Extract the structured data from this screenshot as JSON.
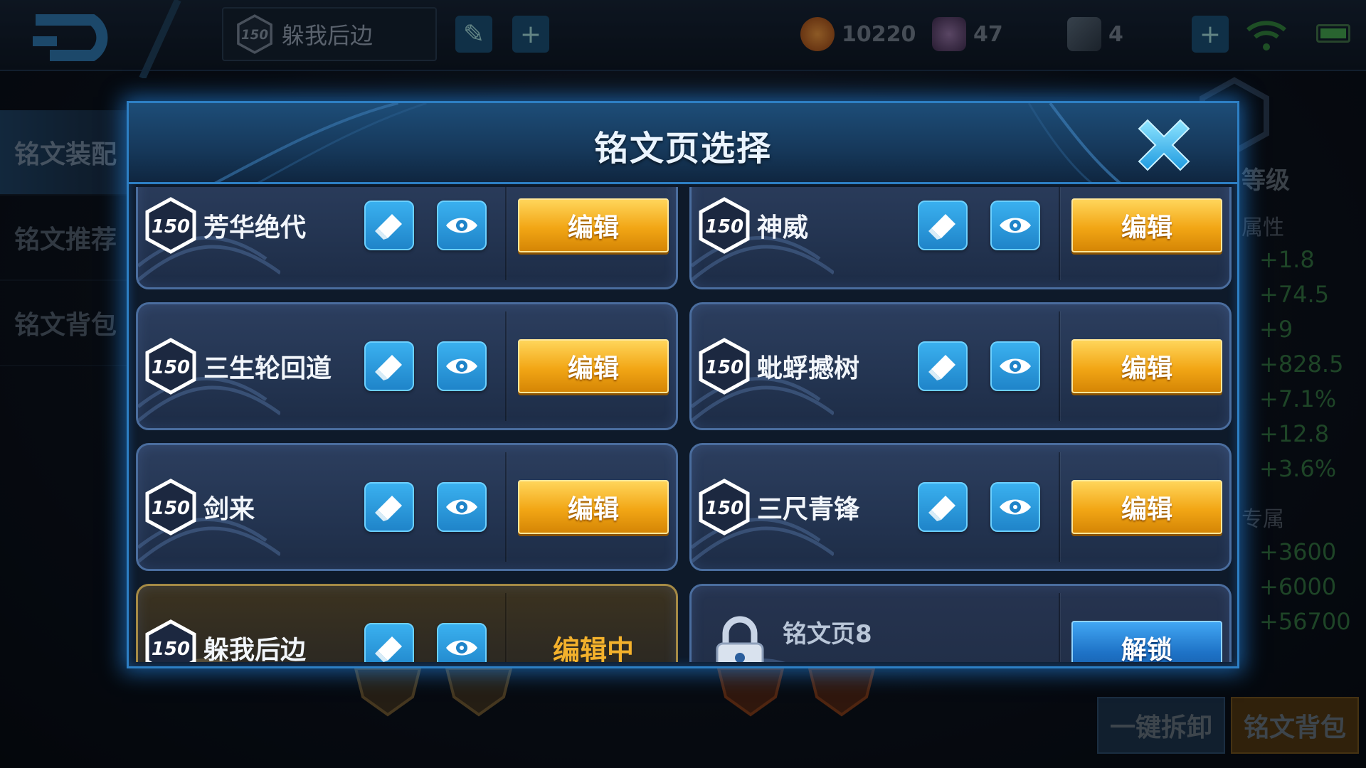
{
  "topbar": {
    "current_page_level": "150",
    "current_page_name": "躲我后边",
    "gold": "10220",
    "diamond": "47",
    "ticket": "4"
  },
  "sidenav": {
    "items": [
      {
        "label": "铭文装配"
      },
      {
        "label": "铭文推荐"
      },
      {
        "label": "铭文背包"
      }
    ]
  },
  "rightpanel": {
    "level_title": "等级",
    "attr_label": "属性",
    "exclusive_label": "专属",
    "stats": [
      "+1.8",
      "+74.5",
      "+9",
      "+828.5",
      "+7.1%",
      "+12.8",
      "+3.6%"
    ],
    "exclusive_stats": [
      "+3600",
      "+6000",
      "+56700"
    ],
    "unequip_btn": "一键拆卸",
    "bag_btn": "铭文背包"
  },
  "modal": {
    "title": "铭文页选择",
    "edit_label": "编辑",
    "editing_label": "编辑中",
    "unlock_label": "解锁",
    "pages": [
      {
        "level": "150",
        "name": "芳华绝代"
      },
      {
        "level": "150",
        "name": "神威"
      },
      {
        "level": "150",
        "name": "三生轮回道"
      },
      {
        "level": "150",
        "name": "蚍蜉撼树"
      },
      {
        "level": "150",
        "name": "剑来"
      },
      {
        "level": "150",
        "name": "三尺青锋"
      },
      {
        "level": "150",
        "name": "躲我后边"
      }
    ],
    "locked_page": {
      "name": "铭文页8"
    }
  },
  "colors": {
    "accent_blue": "#2d7fc4",
    "edit_gold": "#f2a615",
    "editing_text": "#f3b12c",
    "unlock_blue": "#1e72c6"
  }
}
